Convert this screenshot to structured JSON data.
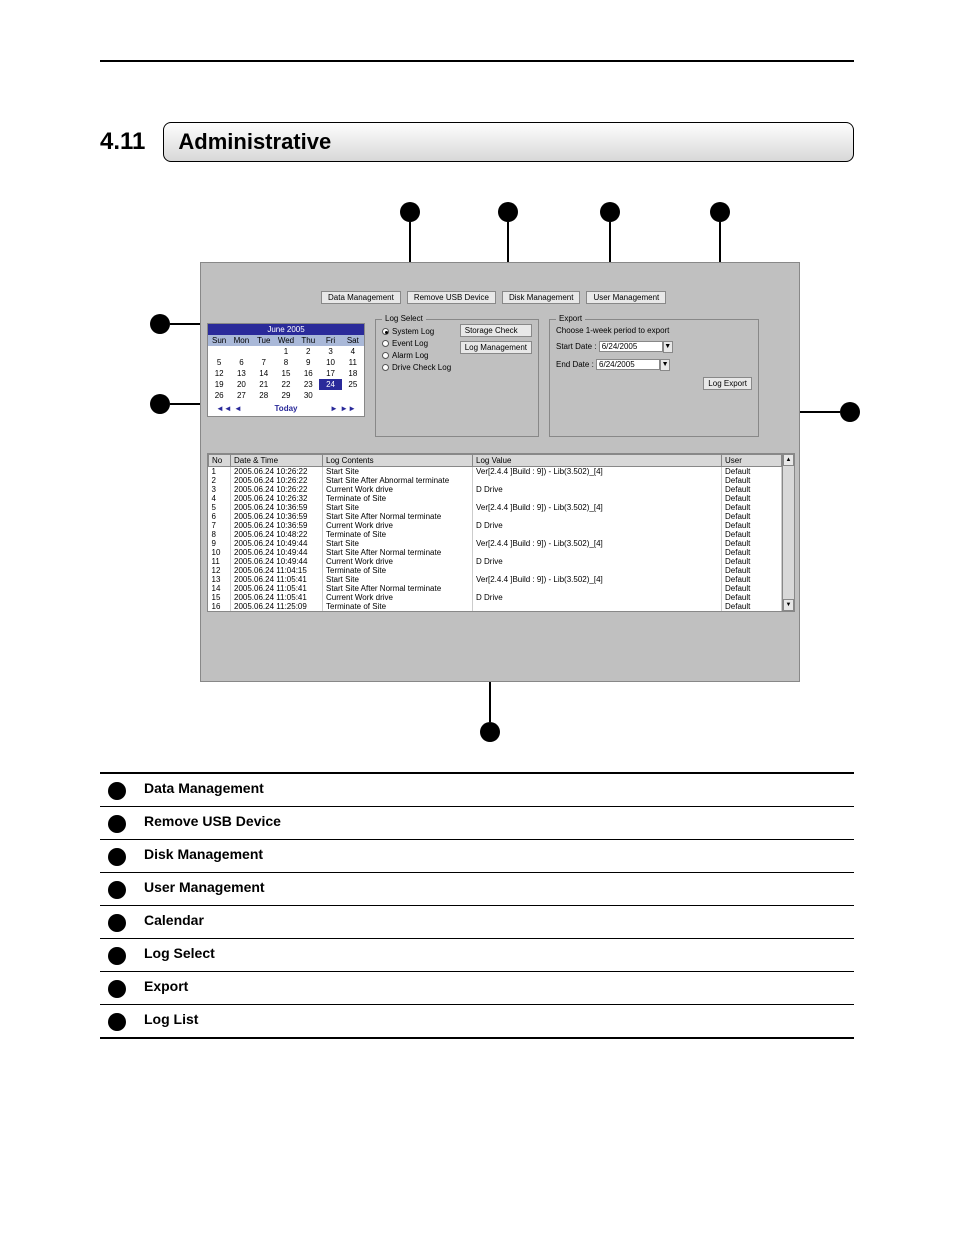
{
  "section": {
    "number": "4.11",
    "title": "Administrative"
  },
  "tabs": {
    "data_mgmt": "Data Management",
    "remove_usb": "Remove USB Device",
    "disk_mgmt": "Disk Management",
    "user_mgmt": "User Management"
  },
  "calendar": {
    "title": "June 2005",
    "days": [
      "Sun",
      "Mon",
      "Tue",
      "Wed",
      "Thu",
      "Fri",
      "Sat"
    ],
    "weeks": [
      [
        "",
        "",
        "",
        "1",
        "2",
        "3",
        "4"
      ],
      [
        "5",
        "6",
        "7",
        "8",
        "9",
        "10",
        "11"
      ],
      [
        "12",
        "13",
        "14",
        "15",
        "16",
        "17",
        "18"
      ],
      [
        "19",
        "20",
        "21",
        "22",
        "23",
        "24",
        "25"
      ],
      [
        "26",
        "27",
        "28",
        "29",
        "30",
        "",
        ""
      ]
    ],
    "selected": "24",
    "today_label": "Today"
  },
  "log_select": {
    "title": "Log Select",
    "system": "System Log",
    "event": "Event Log",
    "alarm": "Alarm Log",
    "drive": "Drive Check Log",
    "storage_check_btn": "Storage Check",
    "log_mgmt_btn": "Log Management"
  },
  "export": {
    "title": "Export",
    "hint": "Choose 1-week period to export",
    "start_label": "Start Date :",
    "end_label": "End Date :",
    "start_value": "6/24/2005",
    "end_value": "6/24/2005",
    "export_btn": "Log Export"
  },
  "log_table": {
    "headers": {
      "no": "No",
      "dt": "Date & Time",
      "contents": "Log Contents",
      "value": "Log Value",
      "user": "User"
    },
    "rows": [
      {
        "no": "1",
        "dt": "2005.06.24 10:26:22",
        "contents": "Start Site",
        "value": "Ver[2.4.4 ]Build : 9]) - Lib(3.502)_[4]",
        "user": "Default"
      },
      {
        "no": "2",
        "dt": "2005.06.24 10:26:22",
        "contents": "Start Site After Abnormal terminate",
        "value": "",
        "user": "Default"
      },
      {
        "no": "3",
        "dt": "2005.06.24 10:26:22",
        "contents": "Current Work drive",
        "value": "D Drive",
        "user": "Default"
      },
      {
        "no": "4",
        "dt": "2005.06.24 10:26:32",
        "contents": "Terminate of Site",
        "value": "",
        "user": "Default"
      },
      {
        "no": "5",
        "dt": "2005.06.24 10:36:59",
        "contents": "Start Site",
        "value": "Ver[2.4.4 ]Build : 9]) - Lib(3.502)_[4]",
        "user": "Default"
      },
      {
        "no": "6",
        "dt": "2005.06.24 10:36:59",
        "contents": "Start Site After Normal terminate",
        "value": "",
        "user": "Default"
      },
      {
        "no": "7",
        "dt": "2005.06.24 10:36:59",
        "contents": "Current Work drive",
        "value": "D Drive",
        "user": "Default"
      },
      {
        "no": "8",
        "dt": "2005.06.24 10:48:22",
        "contents": "Terminate of Site",
        "value": "",
        "user": "Default"
      },
      {
        "no": "9",
        "dt": "2005.06.24 10:49:44",
        "contents": "Start Site",
        "value": "Ver[2.4.4 ]Build : 9]) - Lib(3.502)_[4]",
        "user": "Default"
      },
      {
        "no": "10",
        "dt": "2005.06.24 10:49:44",
        "contents": "Start Site After Normal terminate",
        "value": "",
        "user": "Default"
      },
      {
        "no": "11",
        "dt": "2005.06.24 10:49:44",
        "contents": "Current Work drive",
        "value": "D Drive",
        "user": "Default"
      },
      {
        "no": "12",
        "dt": "2005.06.24 11:04:15",
        "contents": "Terminate of Site",
        "value": "",
        "user": "Default"
      },
      {
        "no": "13",
        "dt": "2005.06.24 11:05:41",
        "contents": "Start Site",
        "value": "Ver[2.4.4 ]Build : 9]) - Lib(3.502)_[4]",
        "user": "Default"
      },
      {
        "no": "14",
        "dt": "2005.06.24 11:05:41",
        "contents": "Start Site After Normal terminate",
        "value": "",
        "user": "Default"
      },
      {
        "no": "15",
        "dt": "2005.06.24 11:05:41",
        "contents": "Current Work drive",
        "value": "D Drive",
        "user": "Default"
      },
      {
        "no": "16",
        "dt": "2005.06.24 11:25:09",
        "contents": "Terminate of Site",
        "value": "",
        "user": "Default"
      }
    ]
  },
  "legend": [
    "Data Management",
    "Remove USB Device",
    "Disk Management",
    "User Management",
    "Calendar",
    "Log Select",
    "Export",
    "Log List"
  ]
}
